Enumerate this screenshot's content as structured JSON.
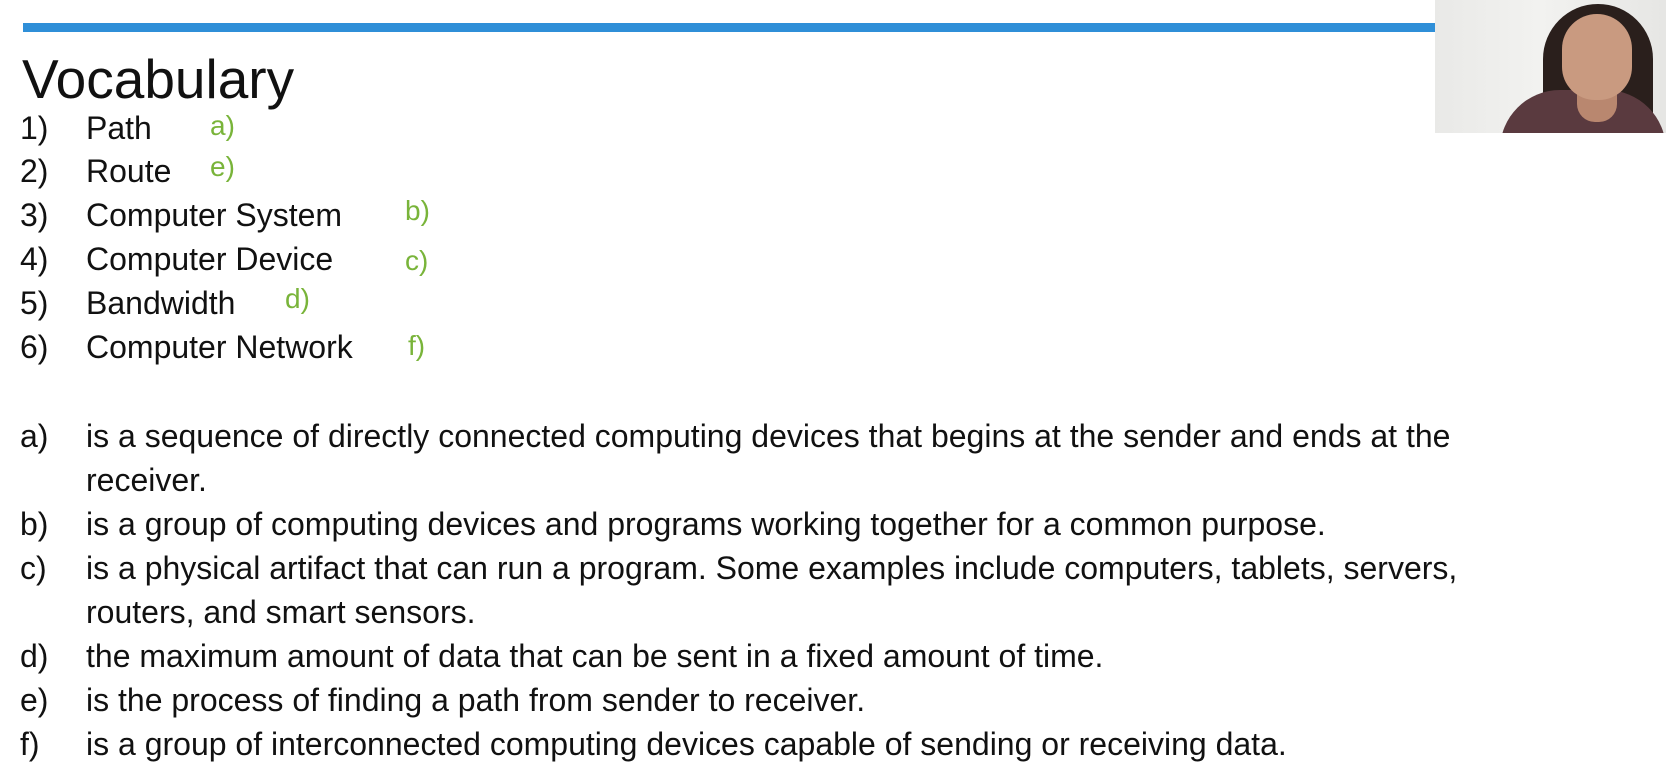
{
  "slide": {
    "title": "Vocabulary",
    "accent_color": "#2f8fd8",
    "answer_color": "#79b43a",
    "terms": [
      {
        "num": "1)",
        "term": "Path",
        "answer": "a)"
      },
      {
        "num": "2)",
        "term": "Route",
        "answer": "e)"
      },
      {
        "num": "3)",
        "term": "Computer System",
        "answer": "b)"
      },
      {
        "num": "4)",
        "term": "Computer Device",
        "answer": "c)"
      },
      {
        "num": "5)",
        "term": "Bandwidth",
        "answer": "d)"
      },
      {
        "num": "6)",
        "term": "Computer Network",
        "answer": "f)"
      }
    ],
    "definitions": [
      {
        "letter": "a)",
        "text": "is a sequence of directly connected computing devices that begins at the sender and ends at the",
        "text2": "receiver."
      },
      {
        "letter": "b)",
        "text": "is a group of computing devices and programs working together for a common purpose."
      },
      {
        "letter": "c)",
        "text": "is a physical artifact that can run a program. Some examples include computers, tablets, servers,",
        "text2": "routers, and smart sensors."
      },
      {
        "letter": "d)",
        "text": "the maximum amount of data that can be sent in a fixed amount of time."
      },
      {
        "letter": "e)",
        "text": "is the process of finding a path from sender to receiver."
      },
      {
        "letter": "f)",
        "text": "is a group of interconnected computing devices capable of sending or receiving data."
      }
    ]
  }
}
